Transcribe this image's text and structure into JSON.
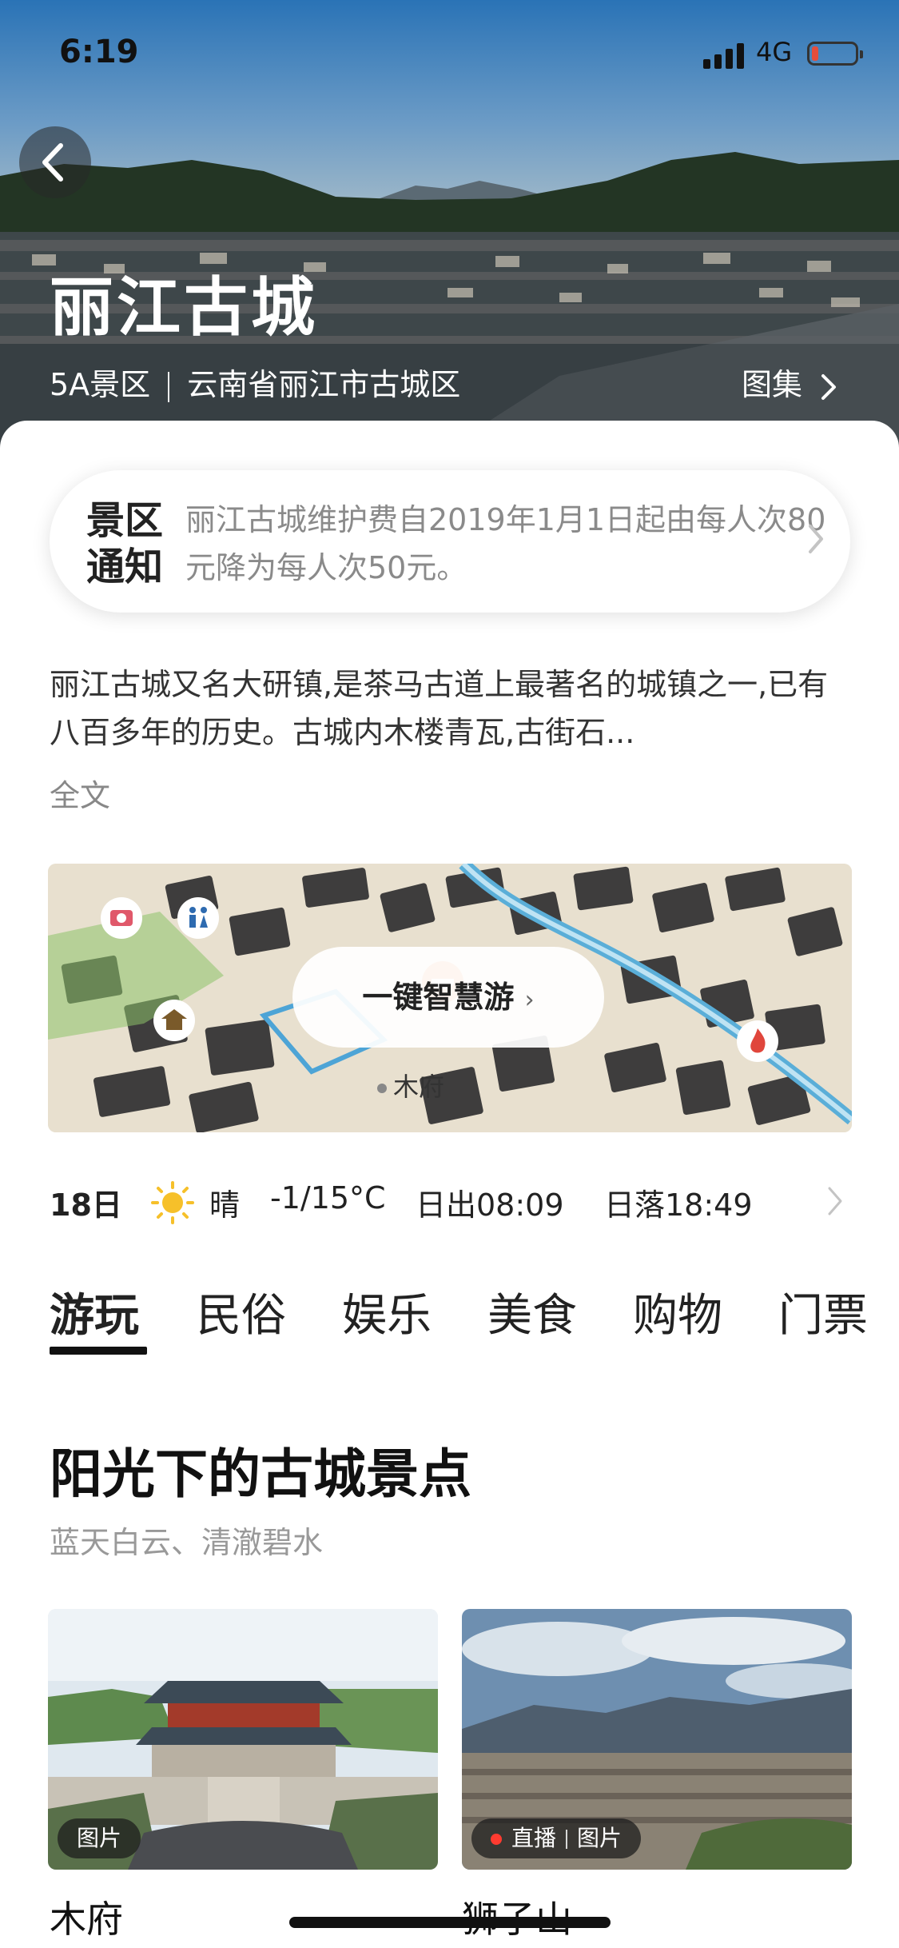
{
  "status_bar": {
    "time": "6:19",
    "network": "4G"
  },
  "hero": {
    "title": "丽江古城",
    "level": "5A景区",
    "location": "云南省丽江市古城区",
    "gallery_label": "图集"
  },
  "notice": {
    "tag": "景区通知",
    "text": "丽江古城维护费自2019年1月1日起由每人次80元降为每人次50元。"
  },
  "intro": {
    "text": "丽江古城又名大研镇,是茶马古道上最著名的城镇之一,已有八百多年的历史。古城内木楼青瓦,古街石...",
    "more_label": "全文"
  },
  "map": {
    "button_label": "一键智慧游",
    "place_label": "木府",
    "icons": [
      "camera-icon",
      "restroom-icon",
      "temple-icon",
      "food-icon",
      "fire-icon"
    ]
  },
  "weather": {
    "date": "18日",
    "condition": "晴",
    "temperature": "-1/15°C",
    "sunrise": "日出08:09",
    "sunset": "日落18:49"
  },
  "tabs": [
    "游玩",
    "民俗",
    "娱乐",
    "美食",
    "购物",
    "门票"
  ],
  "active_tab": "游玩",
  "section": {
    "title": "阳光下的古城景点",
    "subtitle": "蓝天白云、清澈碧水"
  },
  "cards": [
    {
      "name": "木府",
      "badge": [
        "图片"
      ]
    },
    {
      "name": "狮子山",
      "badge_live": "直播",
      "badge": [
        "图片"
      ]
    }
  ]
}
